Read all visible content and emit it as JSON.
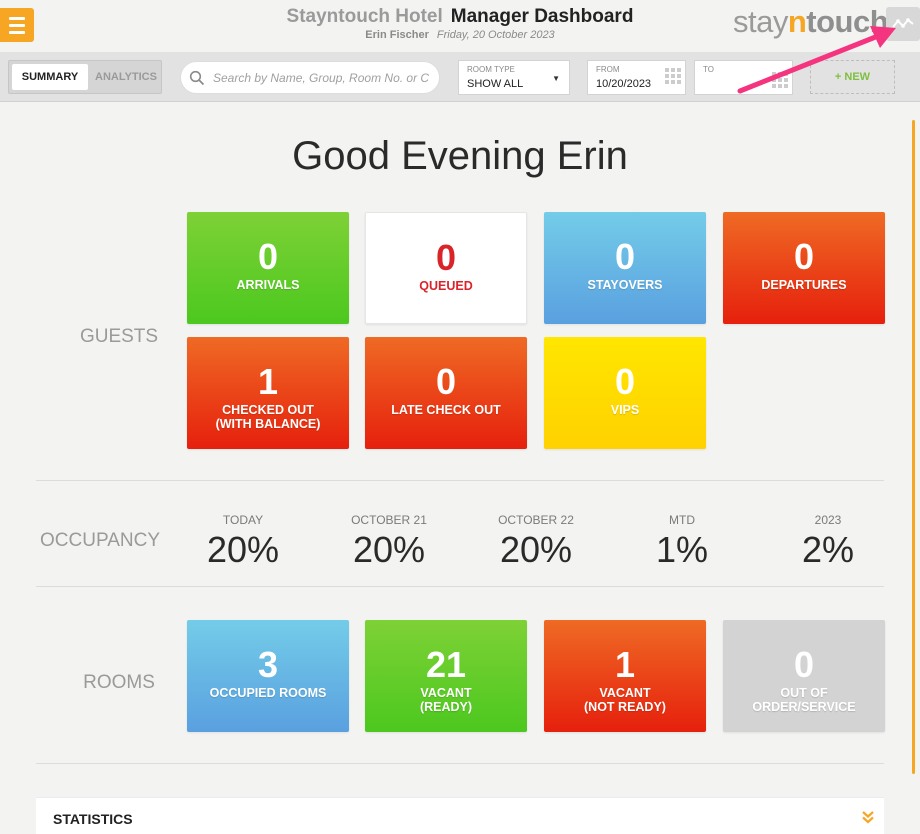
{
  "header": {
    "hotel_name": "Stayntouch Hotel",
    "dashboard_title": "Manager Dashboard",
    "user_name": "Erin Fischer",
    "date": "Friday, 20 October 2023",
    "logo": {
      "part1": "stay",
      "part2": "n",
      "part3": "touch"
    }
  },
  "toolbar": {
    "tabs": [
      {
        "label": "SUMMARY",
        "active": true
      },
      {
        "label": "ANALYTICS",
        "active": false
      }
    ],
    "search_placeholder": "Search by Name, Group, Room No. or C",
    "room_type": {
      "label": "ROOM TYPE",
      "value": "SHOW ALL"
    },
    "from": {
      "label": "FROM",
      "value": "10/20/2023"
    },
    "to": {
      "label": "TO",
      "value": ""
    },
    "new_label": "+ NEW"
  },
  "greeting": "Good Evening Erin",
  "guests": {
    "label": "GUESTS",
    "tiles": [
      {
        "value": "0",
        "label": "ARRIVALS"
      },
      {
        "value": "0",
        "label": "QUEUED"
      },
      {
        "value": "0",
        "label": "STAYOVERS"
      },
      {
        "value": "0",
        "label": "DEPARTURES"
      },
      {
        "value": "1",
        "label": "CHECKED OUT",
        "label2": "(WITH BALANCE)"
      },
      {
        "value": "0",
        "label": "LATE CHECK OUT"
      },
      {
        "value": "0",
        "label": "VIPS"
      }
    ]
  },
  "occupancy": {
    "label": "OCCUPANCY",
    "columns": [
      {
        "header": "TODAY",
        "value": "20%"
      },
      {
        "header": "OCTOBER 21",
        "value": "20%"
      },
      {
        "header": "OCTOBER 22",
        "value": "20%"
      },
      {
        "header": "MTD",
        "value": "1%"
      },
      {
        "header": "2023",
        "value": "2%"
      }
    ]
  },
  "rooms": {
    "label": "ROOMS",
    "tiles": [
      {
        "value": "3",
        "label": "OCCUPIED ROOMS"
      },
      {
        "value": "21",
        "label": "VACANT",
        "label2": "(READY)"
      },
      {
        "value": "1",
        "label": "VACANT",
        "label2": "(NOT READY)"
      },
      {
        "value": "0",
        "label": "OUT OF",
        "label2": "ORDER/SERVICE"
      }
    ]
  },
  "statistics": {
    "label": "STATISTICS"
  },
  "colors": {
    "accent": "#f6a623",
    "green": "#4cc81f",
    "red": "#e6200d",
    "blue": "#5aa0e0",
    "yellow": "#ffd100",
    "annotation_arrow": "#f5347f"
  },
  "icons": [
    "menu-icon",
    "analytics-chart-icon",
    "search-icon",
    "caret-down-icon",
    "calendar-icon",
    "double-chevron-down-icon"
  ]
}
